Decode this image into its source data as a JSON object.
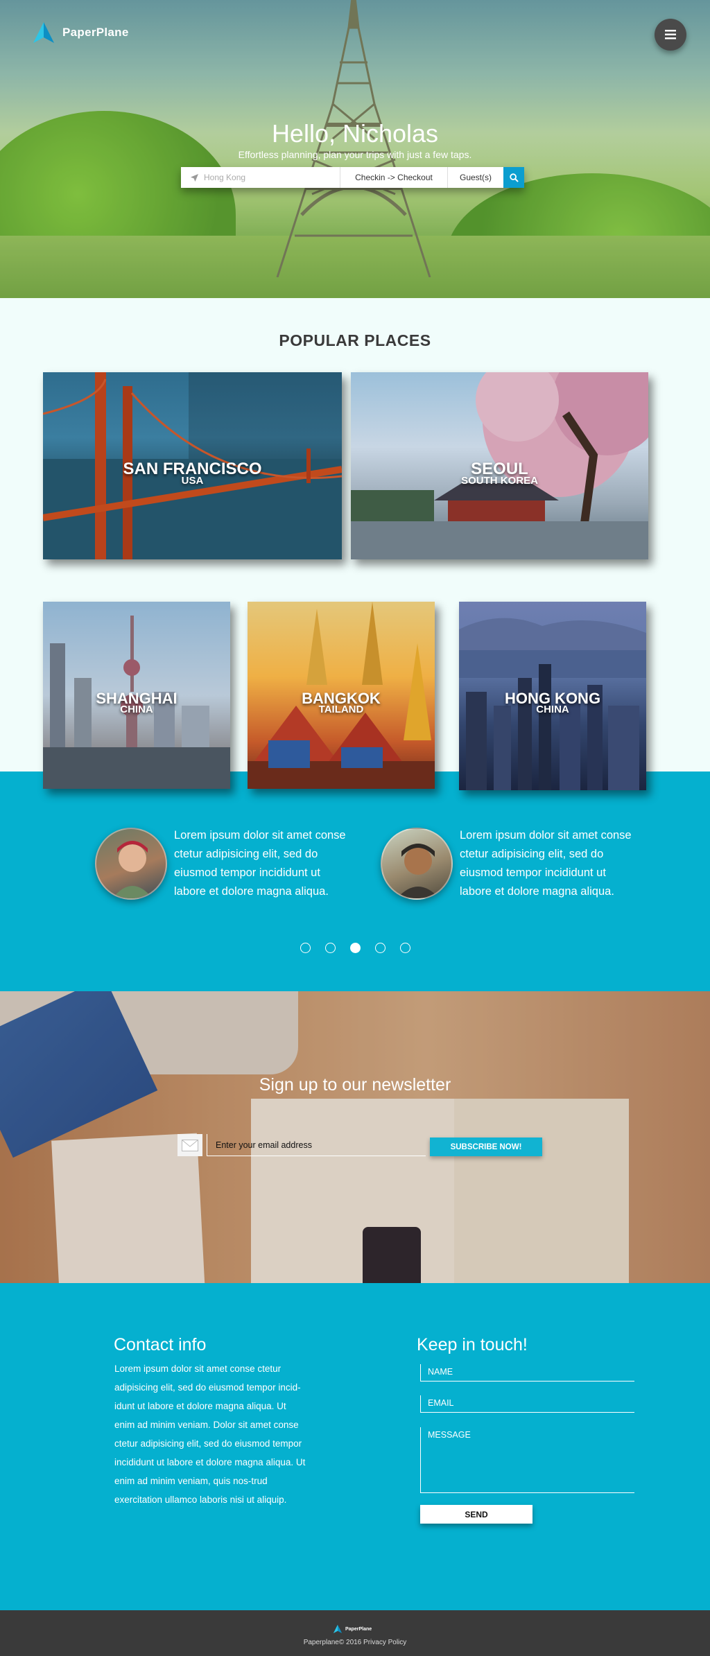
{
  "brand": {
    "name": "PaperPlane",
    "accent": "#05b0cf",
    "dark": "#3a3a3a"
  },
  "hero": {
    "title": "Hello, Nicholas",
    "subtitle": "Effortless planning, plan your trips with just a few taps.",
    "search": {
      "location_placeholder": "Hong Kong",
      "dates_label": "Checkin -> Checkout",
      "guests_label": "Guest(s)",
      "location_icon": "location-arrow-icon",
      "submit_icon": "search-icon"
    },
    "menu_icon": "hamburger-icon"
  },
  "popular": {
    "title": "POPULAR PLACES",
    "places": [
      {
        "city": "SAN FRANCISCO",
        "country": "USA"
      },
      {
        "city": "SEOUL",
        "country": "SOUTH KOREA"
      },
      {
        "city": "SHANGHAI",
        "country": "CHINA"
      },
      {
        "city": "BANGKOK",
        "country": "TAILAND"
      },
      {
        "city": "HONG KONG",
        "country": "CHINA"
      }
    ]
  },
  "testimonials": [
    {
      "text": "Lorem ipsum dolor sit amet conse ctetur adipisicing elit, sed do eiusmod tempor incididunt ut labore et dolore magna aliqua."
    },
    {
      "text": "Lorem ipsum dolor sit amet conse ctetur adipisicing elit, sed do eiusmod tempor incididunt ut labore et dolore magna aliqua."
    }
  ],
  "carousel": {
    "count": 5,
    "active_index": 2
  },
  "newsletter": {
    "title": "Sign up to our newsletter",
    "email_placeholder": "Enter your email address",
    "button_label": "SUBSCRIBE NOW!",
    "icon": "envelope-icon"
  },
  "contact": {
    "info_title": "Contact info",
    "info_body": "Lorem ipsum dolor sit amet conse ctetur adipisicing elit, sed do eiusmod tempor incid-idunt ut labore et dolore magna aliqua. Ut enim ad minim veniam. Dolor sit amet conse ctetur adipisicing elit, sed do eiusmod tempor incididunt ut labore et dolore magna aliqua. Ut enim ad minim veniam, quis nos-trud exercitation ullamco laboris nisi ut aliquip.",
    "form_title": "Keep in touch!",
    "name_placeholder": "NAME",
    "email_placeholder": "EMAIL",
    "message_placeholder": "MESSAGE",
    "send_label": "SEND"
  },
  "footer": {
    "logo_text": "PaperPlane",
    "copyright": "Paperplane© 2016",
    "privacy_label": "Privacy Policy"
  }
}
